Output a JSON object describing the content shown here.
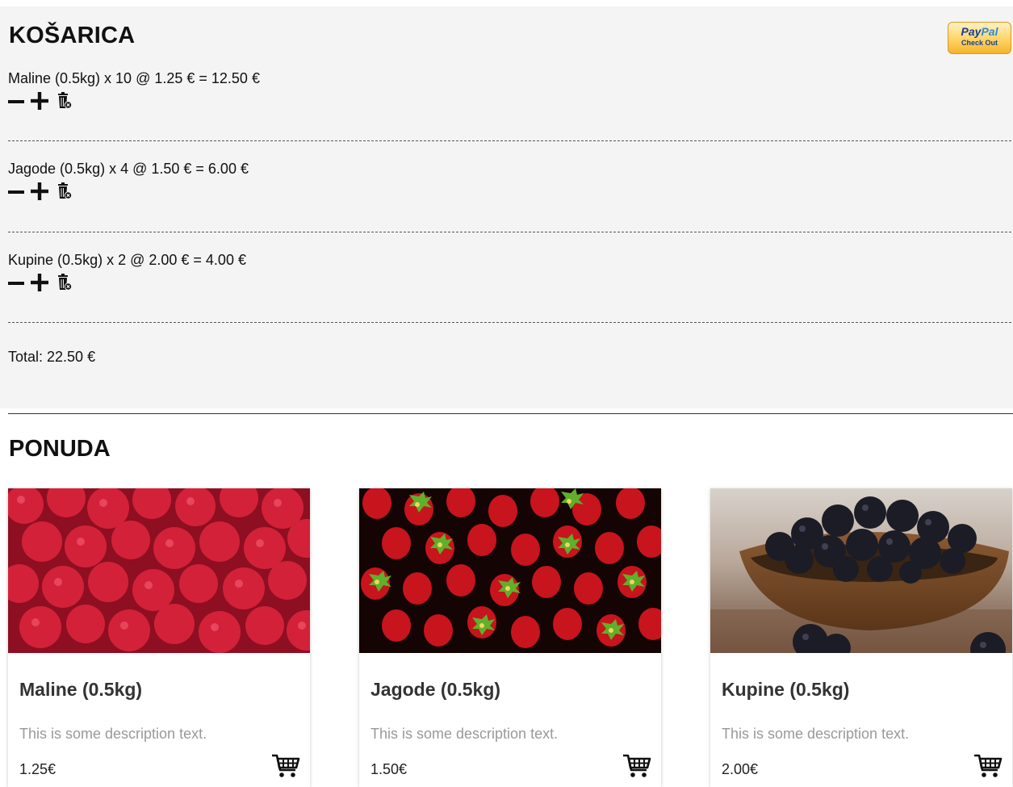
{
  "cart": {
    "title": "KOŠARICA",
    "paypal": {
      "logo_pay": "Pay",
      "logo_pal": "Pal",
      "sub_label": "Check Out"
    },
    "items": [
      {
        "text": "Maline (0.5kg) x 10 @ 1.25 € = 12.50 €"
      },
      {
        "text": "Jagode (0.5kg) x 4 @ 1.50 € = 6.00 €"
      },
      {
        "text": "Kupine (0.5kg) x 2 @ 2.00 € = 4.00 €"
      }
    ],
    "total": "Total: 22.50 €"
  },
  "offer": {
    "title": "PONUDA",
    "products": [
      {
        "name": "Maline (0.5kg)",
        "description": "This is some description text.",
        "price": "1.25€"
      },
      {
        "name": "Jagode (0.5kg)",
        "description": "This is some description text.",
        "price": "1.50€"
      },
      {
        "name": "Kupine (0.5kg)",
        "description": "This is some description text.",
        "price": "2.00€"
      }
    ]
  },
  "icons": {
    "decrease": "minus-icon",
    "increase": "plus-icon",
    "remove": "trash-icon",
    "add_to_cart": "shopping-cart-icon"
  }
}
